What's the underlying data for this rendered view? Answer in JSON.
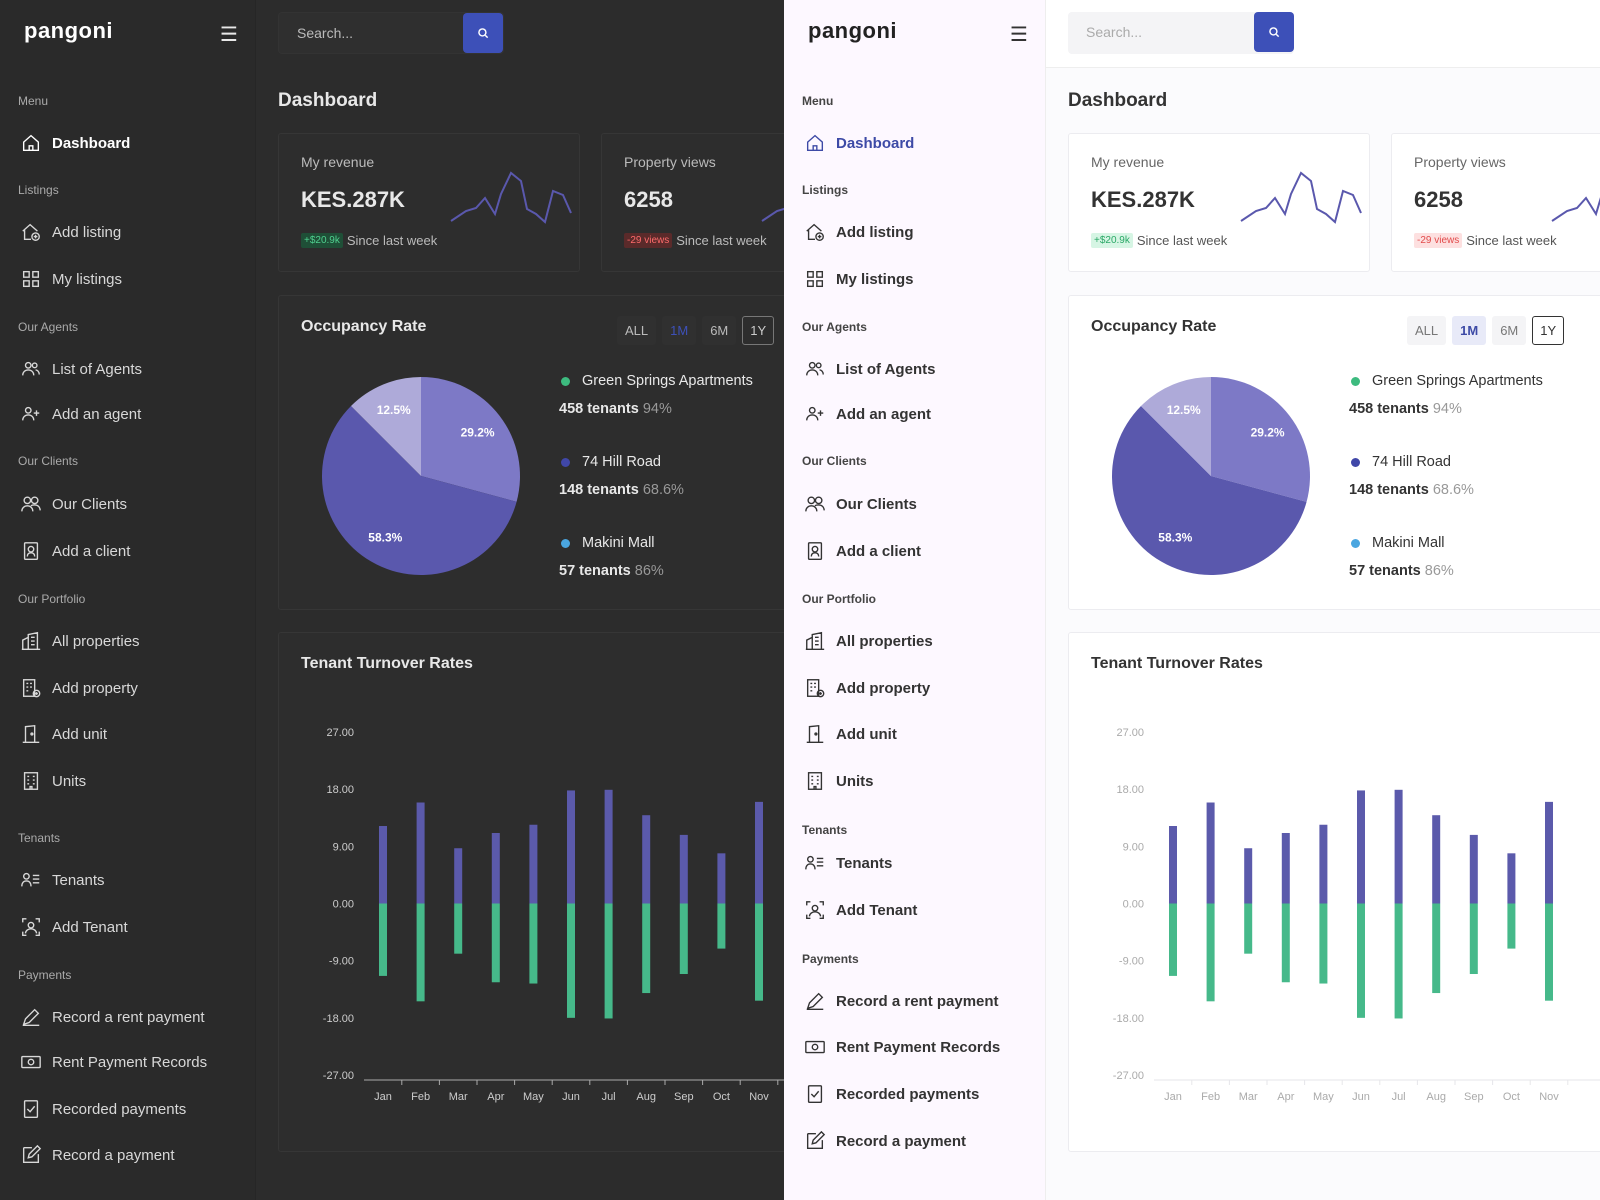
{
  "app": {
    "logo": "pangoni",
    "menu_icon": "hamburger-icon"
  },
  "search": {
    "placeholder": "Search...",
    "icon": "search-icon"
  },
  "sidebar": {
    "sections": [
      {
        "title": "Menu",
        "items": [
          {
            "label": "Dashboard",
            "icon": "home-icon",
            "active": true
          }
        ]
      },
      {
        "title": "Listings",
        "items": [
          {
            "label": "Add listing",
            "icon": "house-plus-icon"
          },
          {
            "label": "My listings",
            "icon": "grid-icon"
          }
        ]
      },
      {
        "title": "Our Agents",
        "items": [
          {
            "label": "List of Agents",
            "icon": "users-icon"
          },
          {
            "label": "Add an agent",
            "icon": "user-plus-icon"
          }
        ]
      },
      {
        "title": "Our Clients",
        "items": [
          {
            "label": "Our Clients",
            "icon": "people-icon"
          },
          {
            "label": "Add a client",
            "icon": "contact-card-icon"
          }
        ]
      },
      {
        "title": "Our Portfolio",
        "items": [
          {
            "label": "All properties",
            "icon": "buildings-icon"
          },
          {
            "label": "Add property",
            "icon": "building-plus-icon"
          },
          {
            "label": "Add unit",
            "icon": "door-icon"
          },
          {
            "label": "Units",
            "icon": "building-icon"
          }
        ]
      },
      {
        "title": "Tenants",
        "items": [
          {
            "label": "Tenants",
            "icon": "user-list-icon"
          },
          {
            "label": "Add Tenant",
            "icon": "user-frame-icon"
          }
        ]
      },
      {
        "title": "Payments",
        "items": [
          {
            "label": "Record a rent payment",
            "icon": "pen-icon"
          },
          {
            "label": "Rent Payment Records",
            "icon": "cash-icon"
          },
          {
            "label": "Recorded payments",
            "icon": "checklist-icon"
          },
          {
            "label": "Record a payment",
            "icon": "edit-icon"
          }
        ]
      }
    ]
  },
  "page": {
    "title": "Dashboard"
  },
  "stats": [
    {
      "label": "My revenue",
      "value": "KES.287K",
      "badge": "+$20.9k",
      "trend": "up",
      "since": "Since last week"
    },
    {
      "label": "Property views",
      "value": "6258",
      "badge": "-29 views",
      "trend": "down",
      "since": "Since last week"
    }
  ],
  "occupancy": {
    "title": "Occupancy Rate",
    "ranges": [
      "ALL",
      "1M",
      "6M",
      "1Y"
    ],
    "active_range": "1M",
    "legend": [
      {
        "name": "Green Springs Apartments",
        "tenants": "458 tenants",
        "pct": "94%",
        "color": "#3dbb7f"
      },
      {
        "name": "74 Hill Road",
        "tenants": "148 tenants",
        "pct": "68.6%",
        "color": "#4047a8"
      },
      {
        "name": "Makini Mall",
        "tenants": "57 tenants",
        "pct": "86%",
        "color": "#4aa6e0"
      }
    ]
  },
  "chart_data": [
    {
      "type": "pie",
      "values": [
        29.2,
        58.3,
        12.5
      ],
      "labels": [
        "29.2%",
        "58.3%",
        "12.5%"
      ],
      "colors": [
        "#7d79c6",
        "#5a58ad",
        "#aeaad9"
      ]
    },
    {
      "type": "bar",
      "title": "Tenant Turnover Rates",
      "categories": [
        "Jan",
        "Feb",
        "Mar",
        "Apr",
        "May",
        "Jun",
        "Jul",
        "Aug",
        "Sep",
        "Oct",
        "Nov"
      ],
      "series": [
        {
          "values": [
            12.2,
            15.9,
            8.7,
            11.1,
            12.4,
            17.8,
            17.9,
            13.9,
            10.8,
            7.9,
            16.0
          ],
          "color": "#5b5aab"
        },
        {
          "values": [
            -11.4,
            -15.4,
            -7.9,
            -12.4,
            -12.6,
            -18.0,
            -18.1,
            -14.1,
            -11.1,
            -7.1,
            -15.3
          ],
          "color": "#46b98a"
        }
      ],
      "yticks": [
        "27.00",
        "18.00",
        "9.00",
        "0.00",
        "-9.00",
        "-18.00",
        "-27.00"
      ],
      "ylim": [
        -27,
        27
      ],
      "grid": false
    }
  ]
}
